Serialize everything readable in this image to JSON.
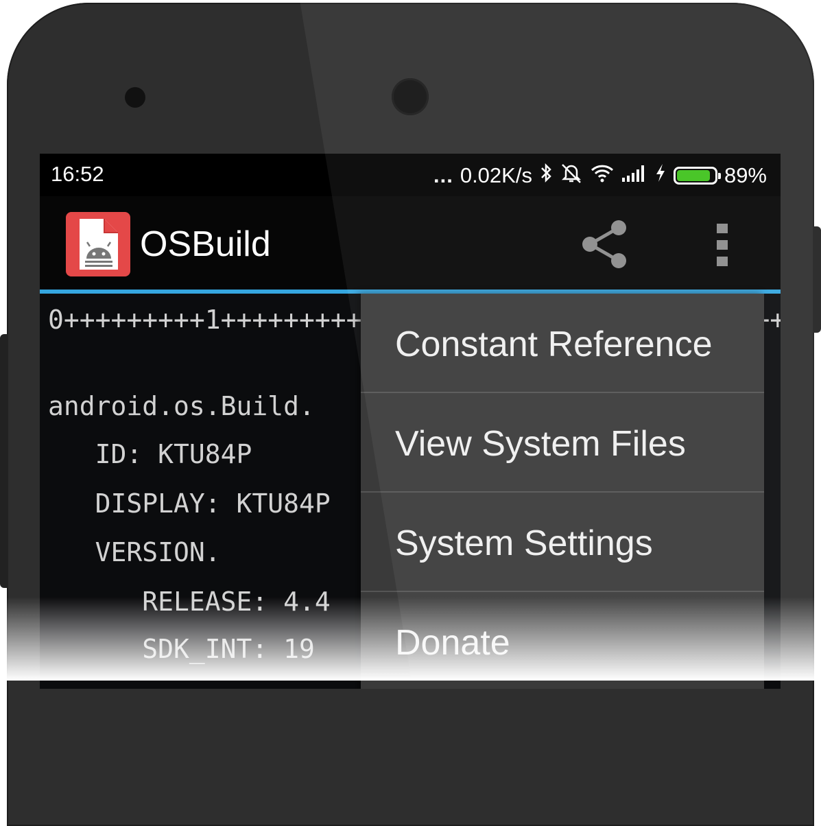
{
  "status_bar": {
    "time": "16:52",
    "activity": "...",
    "net_speed": "0.02K/s",
    "battery_level": 0.89,
    "battery_text": "89%",
    "battery_color": "#3fc31c",
    "icons": [
      "bluetooth-icon",
      "alarm-off-icon",
      "wifi-icon",
      "signal-icon",
      "charging-icon",
      "battery-icon"
    ]
  },
  "action_bar": {
    "app_name": "OSBuild",
    "app_icon": "osbuild-android-document-icon",
    "icon_color": "#e44848",
    "share_icon": "share-icon",
    "overflow_icon": "overflow-menu-icon",
    "accent_color": "#35a6e0"
  },
  "content": {
    "ruler": "0+++++++++1++++++++++2++++++++++3++++++++++4++++++++",
    "lines": [
      "android.os.Build.",
      "   ID: KTU84P",
      "   DISPLAY: KTU84P",
      "   VERSION.",
      "      RELEASE: 4.4",
      "      SDK_INT: 19"
    ]
  },
  "menu": {
    "items": [
      {
        "label": "Constant Reference"
      },
      {
        "label": "View System Files"
      },
      {
        "label": "System Settings"
      },
      {
        "label": "Donate"
      }
    ]
  }
}
